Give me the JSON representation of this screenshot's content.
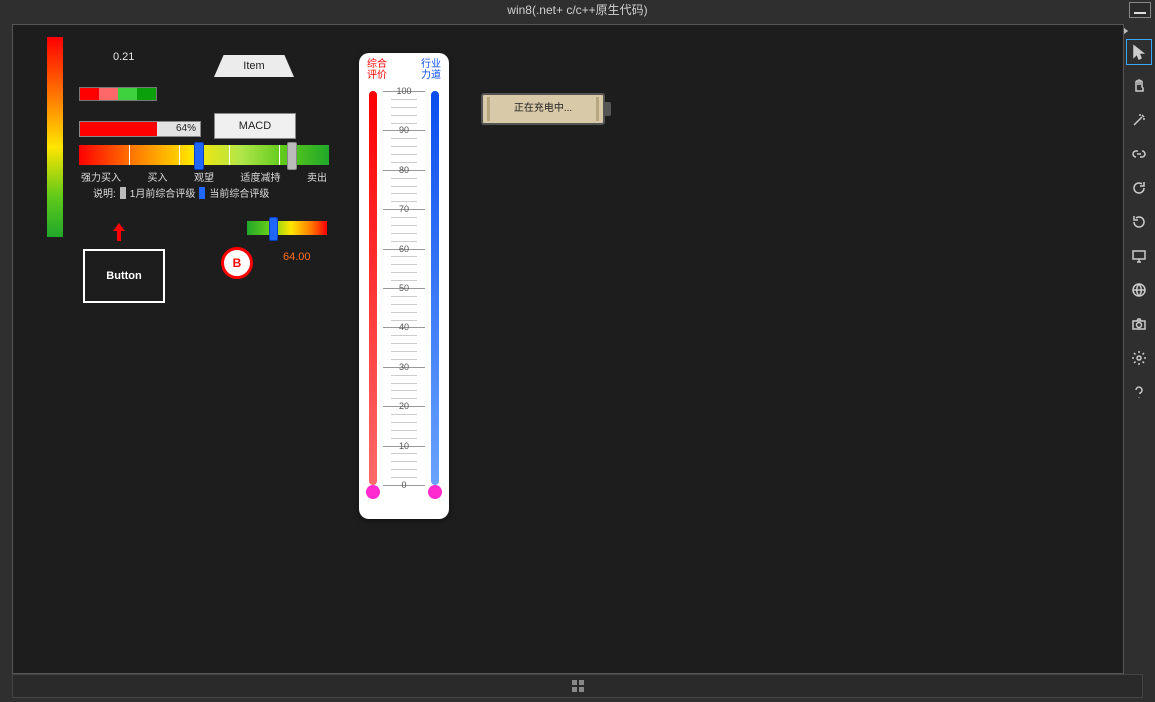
{
  "window": {
    "title": "win8(.net+ c/c++原生代码)"
  },
  "value_top": "0.21",
  "progress": {
    "percent": 64,
    "label": "64%"
  },
  "item_button": "Item",
  "macd_button": "MACD",
  "rainbow_labels": [
    "强力买入",
    "买入",
    "观望",
    "适度减持",
    "卖出"
  ],
  "legend": {
    "prefix": "说明:",
    "m1": "1月前综合评级",
    "m2": "当前综合评级"
  },
  "mini_value": "64.00",
  "b_label": "B",
  "button_label": "Button",
  "thermo": {
    "left_hdr_l1": "综合",
    "left_hdr_l2": "评价",
    "right_hdr_l1": "行业",
    "right_hdr_l2": "力道",
    "max": 100,
    "min": 0,
    "step": 10
  },
  "battery": {
    "text": "正在充电中..."
  },
  "rtool": [
    "pointer",
    "hand",
    "magic",
    "link",
    "rotate-cw",
    "rotate-ccw",
    "monitor",
    "globe",
    "camera",
    "gear",
    "help"
  ]
}
